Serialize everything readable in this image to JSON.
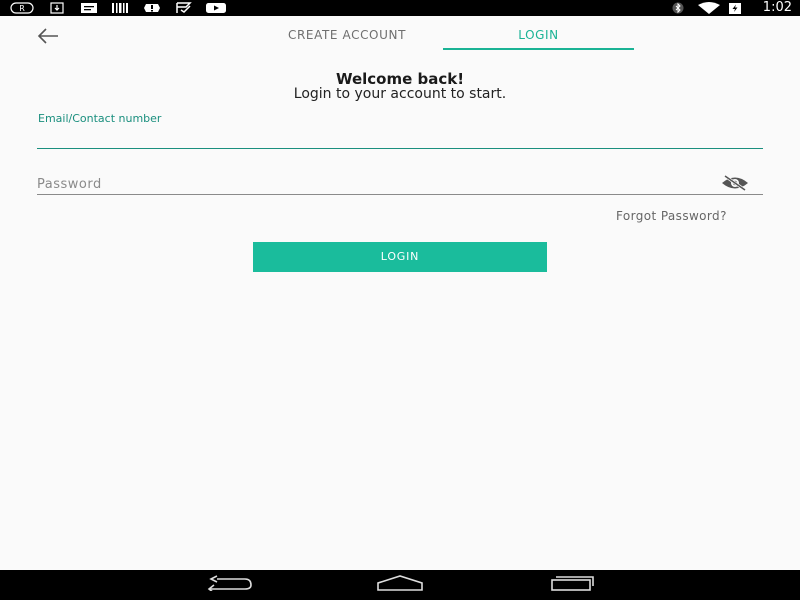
{
  "status_bar": {
    "time": "1:02",
    "left_icons": [
      "registered-icon",
      "download-icon",
      "message-icon",
      "barcode-icon",
      "bug-icon",
      "check-flag-icon",
      "youtube-icon"
    ],
    "right_icons": [
      "bluetooth-icon",
      "wifi-icon",
      "battery-charging-icon"
    ]
  },
  "header": {
    "back_icon": "arrow-left-icon",
    "tabs": [
      {
        "label": "CREATE ACCOUNT",
        "active": false
      },
      {
        "label": "LOGIN",
        "active": true
      }
    ]
  },
  "welcome": {
    "title": "Welcome back!",
    "subtitle": "Login to your account to start."
  },
  "form": {
    "email_label": "Email/Contact number",
    "email_value": "",
    "password_placeholder": "Password",
    "password_value": "",
    "visibility_icon": "eye-off-icon",
    "forgot_label": "Forgot Password?",
    "login_label": "LOGIN"
  },
  "nav_bar": {
    "icons": [
      "back-nav-icon",
      "home-nav-icon",
      "recents-nav-icon"
    ]
  },
  "colors": {
    "accent": "#1abc9c",
    "tab_active": "#1ab395",
    "label": "#1a8f7e",
    "background": "#fafafa"
  }
}
